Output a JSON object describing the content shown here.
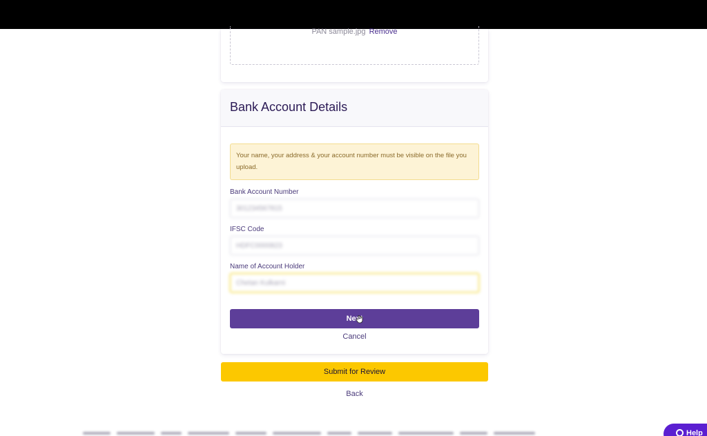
{
  "upload": {
    "file_name": "PAN sample.jpg",
    "remove_label": "Remove"
  },
  "bank": {
    "title": "Bank Account Details",
    "notice": "Your name, your address & your account number must be visible on the file you upload.",
    "account_number": {
      "label": "Bank Account Number",
      "value": "301234567815"
    },
    "ifsc": {
      "label": "IFSC Code",
      "value": "HDFC0000823"
    },
    "holder": {
      "label": "Name of Account Holder",
      "value": "Chetan Kulkarni"
    },
    "next_label": "Next",
    "cancel_label": "Cancel"
  },
  "actions": {
    "submit_label": "Submit for Review",
    "back_label": "Back"
  },
  "help": {
    "label": "Help"
  },
  "colors": {
    "primary": "#5d3e99",
    "accent_yellow": "#fcc800",
    "notice_bg": "#fdf3d6",
    "help_bg": "#5b1fd1"
  }
}
